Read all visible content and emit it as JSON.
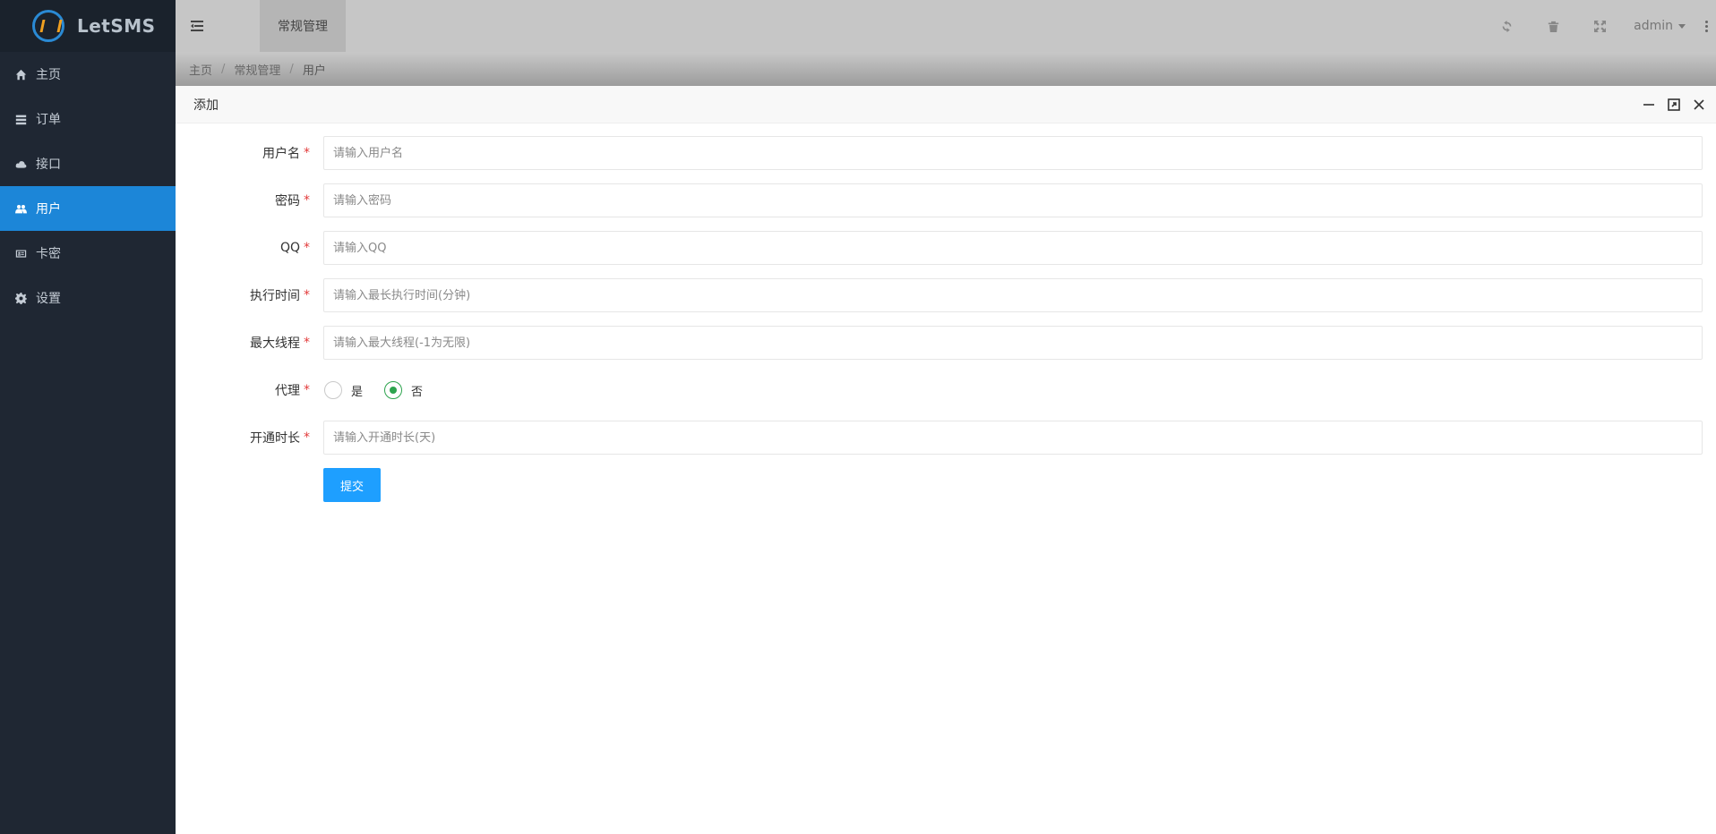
{
  "app": {
    "name": "LetSMS"
  },
  "sidebar": {
    "items": [
      {
        "label": "主页",
        "icon": "home-icon"
      },
      {
        "label": "订单",
        "icon": "list-icon"
      },
      {
        "label": "接口",
        "icon": "cloud-icon"
      },
      {
        "label": "用户",
        "icon": "users-icon",
        "active": true
      },
      {
        "label": "卡密",
        "icon": "id-card-icon"
      },
      {
        "label": "设置",
        "icon": "gear-icon"
      }
    ]
  },
  "header": {
    "tab": "常规管理",
    "user": "admin",
    "icons": [
      "refresh-icon",
      "trash-icon",
      "fullscreen-icon"
    ]
  },
  "breadcrumb": {
    "home": "主页",
    "section": "常规管理",
    "current": "用户",
    "separator": "/"
  },
  "modal": {
    "title": "添加",
    "actions": [
      "minimize-icon",
      "maximize-icon",
      "close-icon"
    ]
  },
  "form": {
    "username": {
      "label": "用户名",
      "placeholder": "请输入用户名",
      "value": ""
    },
    "password": {
      "label": "密码",
      "placeholder": "请输入密码",
      "value": ""
    },
    "qq": {
      "label": "QQ",
      "placeholder": "请输入QQ",
      "value": ""
    },
    "exec_time": {
      "label": "执行时间",
      "placeholder": "请输入最长执行时间(分钟)",
      "value": ""
    },
    "max_threads": {
      "label": "最大线程",
      "placeholder": "请输入最大线程(-1为无限)",
      "value": ""
    },
    "agent": {
      "label": "代理",
      "options": [
        "是",
        "否"
      ],
      "selected": "否"
    },
    "duration": {
      "label": "开通时长",
      "placeholder": "请输入开通时长(天)",
      "value": ""
    },
    "required_mark": "*",
    "submit_label": "提交"
  },
  "colors": {
    "sidebar_bg": "#1f2733",
    "active": "#1c86d8",
    "primary_button": "#1e9fff",
    "radio_checked": "#2da44e",
    "required": "#e23a3a"
  }
}
